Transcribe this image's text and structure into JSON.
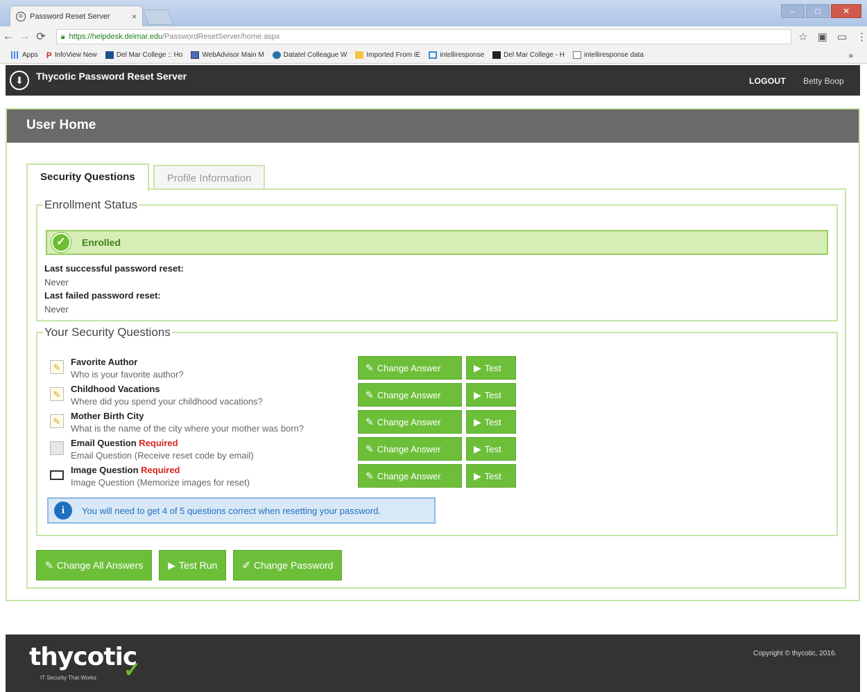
{
  "browser": {
    "tab_title": "Password Reset Server",
    "tab_close": "×",
    "favicon": "®",
    "url_host": "https://helpdesk.delmar.edu",
    "url_path": "/PasswordResetServer/home.aspx",
    "bookmarks": [
      {
        "label": "Apps",
        "icon": "apps-grid-icon"
      },
      {
        "label": "InfoView New",
        "icon": "p-icon"
      },
      {
        "label": "Del Mar College :: Ho",
        "icon": "college-icon"
      },
      {
        "label": "WebAdvisor Main M",
        "icon": "web-icon"
      },
      {
        "label": "Datatel Colleague W",
        "icon": "datatel-icon"
      },
      {
        "label": "Imported From IE",
        "icon": "folder-icon"
      },
      {
        "label": "intelliresponse",
        "icon": "intelliresponse-icon"
      },
      {
        "label": "Del Mar College - H",
        "icon": "college-icon"
      },
      {
        "label": "intelliresponse data",
        "icon": "page-icon"
      }
    ],
    "bookmarks_more": "»"
  },
  "header": {
    "app_title": "Thycotic Password Reset Server",
    "logout": "LOGOUT",
    "user_name": "Betty Boop"
  },
  "page": {
    "title": "User Home",
    "tabs": [
      {
        "label": "Security Questions",
        "active": true
      },
      {
        "label": "Profile Information",
        "active": false
      }
    ]
  },
  "enrollment": {
    "legend": "Enrollment Status",
    "status": "Enrolled",
    "last_success_label": "Last successful password reset:",
    "last_success_value": "Never",
    "last_failed_label": "Last failed password reset:",
    "last_failed_value": "Never"
  },
  "questions": {
    "legend": "Your Security Questions",
    "items": [
      {
        "title": "Favorite Author",
        "required": "",
        "text": "Who is your favorite author?",
        "icon": "pencil-icon"
      },
      {
        "title": "Childhood Vacations",
        "required": "",
        "text": "Where did you spend your childhood vacations?",
        "icon": "pencil-icon"
      },
      {
        "title": "Mother Birth City",
        "required": "",
        "text": "What is the name of the city where your mother was born?",
        "icon": "pencil-icon"
      },
      {
        "title": "Email Question",
        "required": "Required",
        "text": "Email Question (Receive reset code by email)",
        "icon": "email-icon"
      },
      {
        "title": "Image Question",
        "required": "Required",
        "text": "Image Question (Memorize images for reset)",
        "icon": "image-icon"
      }
    ],
    "change_answer_label": "Change Answer",
    "test_label": "Test",
    "info": "You will need to get 4 of 5 questions correct when resetting your password."
  },
  "actions": {
    "change_all": "Change All Answers",
    "test_run": "Test Run",
    "change_password": "Change Password"
  },
  "footer": {
    "logo": "thycotic",
    "tagline": "IT Security That Works",
    "copyright": "Copyright © thycotic, 2016."
  },
  "colors": {
    "accent_green": "#6dbf3a",
    "header_dark": "#333333",
    "panel_header": "#6a6a6a",
    "required_red": "#d9231d",
    "info_blue": "#1f6fbf"
  }
}
